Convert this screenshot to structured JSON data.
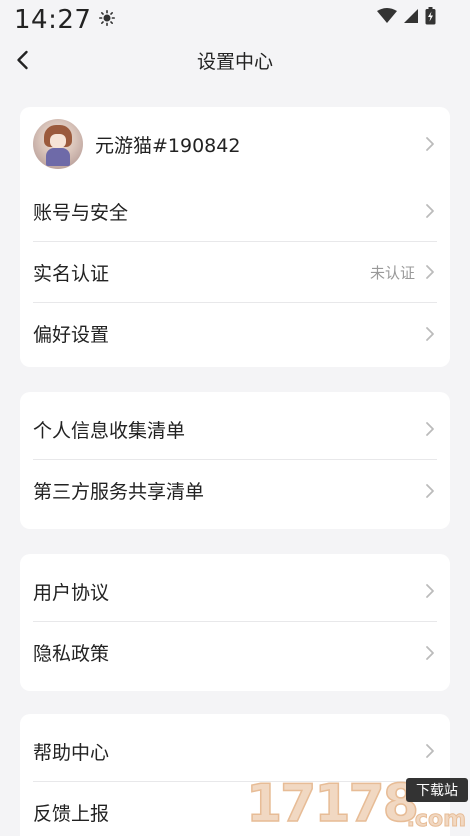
{
  "status_bar": {
    "time": "14:27",
    "icons": [
      "brightness-icon",
      "wifi-icon",
      "signal-icon",
      "battery-icon"
    ]
  },
  "header": {
    "title": "设置中心",
    "back_icon": "chevron-left-icon"
  },
  "profile": {
    "name": "元游猫#190842"
  },
  "section1": {
    "items": [
      {
        "label": "账号与安全",
        "value": ""
      },
      {
        "label": "实名认证",
        "value": "未认证"
      },
      {
        "label": "偏好设置",
        "value": ""
      }
    ]
  },
  "section2": {
    "items": [
      {
        "label": "个人信息收集清单"
      },
      {
        "label": "第三方服务共享清单"
      }
    ]
  },
  "section3": {
    "items": [
      {
        "label": "用户协议"
      },
      {
        "label": "隐私政策"
      }
    ]
  },
  "section4": {
    "items": [
      {
        "label": "帮助中心"
      },
      {
        "label": "反馈上报"
      }
    ]
  },
  "watermark": {
    "number": "17178",
    "badge": "下载站",
    "domain": ".com"
  },
  "colors": {
    "background": "#f4f4f6",
    "card": "#ffffff",
    "text": "#222222",
    "secondary_text": "#999999",
    "chevron": "#bbbbbb"
  }
}
